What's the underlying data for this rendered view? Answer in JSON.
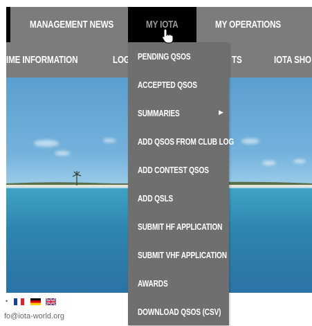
{
  "nav_primary": {
    "items": [
      {
        "label": "MANAGEMENT NEWS"
      },
      {
        "label": "MY IOTA"
      },
      {
        "label": "MY OPERATIONS"
      }
    ]
  },
  "nav_secondary": {
    "items": [
      {
        "label": "IME INFORMATION"
      },
      {
        "label": "LOG"
      },
      {
        "label": "TS"
      },
      {
        "label": "IOTA SHO"
      }
    ]
  },
  "dropdown": {
    "items": [
      {
        "label": "PENDING QSOS"
      },
      {
        "label": "ACCEPTED QSOS"
      },
      {
        "label": "SUMMARIES"
      },
      {
        "label": "ADD QSOS FROM CLUB LOG"
      },
      {
        "label": "ADD CONTEST QSOS"
      },
      {
        "label": "ADD QSLS"
      },
      {
        "label": "SUBMIT HF APPLICATION"
      },
      {
        "label": "SUBMIT VHF APPLICATION"
      },
      {
        "label": "AWARDS"
      },
      {
        "label": "DOWNLOAD QSOS (CSV)"
      }
    ],
    "submenu_icon": "chevron-right-icon"
  },
  "footer": {
    "email": "fo@iota-world.org",
    "flags": [
      "france-flag-icon",
      "germany-flag-icon",
      "uk-flag-icon"
    ]
  },
  "colors": {
    "nav_bg": "#7c7c7c",
    "active_bg": "#000000",
    "dropdown_bg": "#6f6f6f",
    "text": "#ffffff"
  }
}
